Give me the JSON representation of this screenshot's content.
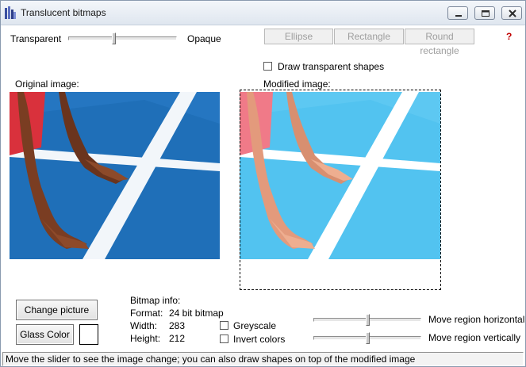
{
  "window": {
    "title": "Translucent bitmaps"
  },
  "opacity": {
    "left_label": "Transparent",
    "right_label": "Opaque",
    "level": 0.42
  },
  "shapes": {
    "ellipse": "Ellipse",
    "rectangle": "Rectangle",
    "round_rectangle": "Round rectangle",
    "draw_transparent": "Draw transparent shapes"
  },
  "help": "?",
  "images": {
    "original_label": "Original image:",
    "modified_label": "Modified image:"
  },
  "buttons": {
    "change_picture": "Change picture",
    "glass_color": "Glass  Color"
  },
  "glass_color_value": "#ffffff",
  "bitmap_info": {
    "heading": "Bitmap info:",
    "format_label": "Format:",
    "format_value": "24 bit bitmap",
    "width_label": "Width:",
    "width_value": "283",
    "height_label": "Height:",
    "height_value": "212"
  },
  "options": {
    "greyscale": "Greyscale",
    "invert": "Invert colors"
  },
  "region": {
    "horizontal_label": "Move region horizontally",
    "vertical_label": "Move region vertically",
    "horizontal_level": 0.5,
    "vertical_level": 0.5
  },
  "status": "Move the slider to see the image change; you can also draw shapes on top of the modified image",
  "colors": {
    "court_blue": "#1f6fb8",
    "court_blue_light": "#52c3f0",
    "titlebar": "#dfe6ef"
  }
}
